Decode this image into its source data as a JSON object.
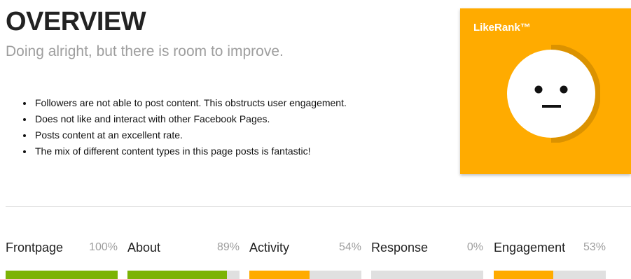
{
  "header": {
    "title": "OVERVIEW",
    "subtitle": "Doing alright, but there is room to improve."
  },
  "findings": [
    "Followers are not able to post content. This obstructs user engagement.",
    "Does not like and interact with other Facebook Pages.",
    "Posts content at an excellent rate.",
    "The mix of different content types in this page posts is fantastic!"
  ],
  "likerank": {
    "label": "LikeRank™",
    "score": 0.5,
    "face": "neutral-face-icon",
    "colors": {
      "card": "#ffab00",
      "ring": "#db9200",
      "face": "#ffffff"
    }
  },
  "metrics": [
    {
      "name": "Frontpage",
      "percent_label": "100%",
      "value": 1.0,
      "color": "#7cb305"
    },
    {
      "name": "About",
      "percent_label": "89%",
      "value": 0.89,
      "color": "#7cb305"
    },
    {
      "name": "Activity",
      "percent_label": "54%",
      "value": 0.54,
      "color": "#ffab00"
    },
    {
      "name": "Response",
      "percent_label": "0%",
      "value": 0.0,
      "color": "#ffab00"
    },
    {
      "name": "Engagement",
      "percent_label": "53%",
      "value": 0.53,
      "color": "#ffab00"
    }
  ]
}
